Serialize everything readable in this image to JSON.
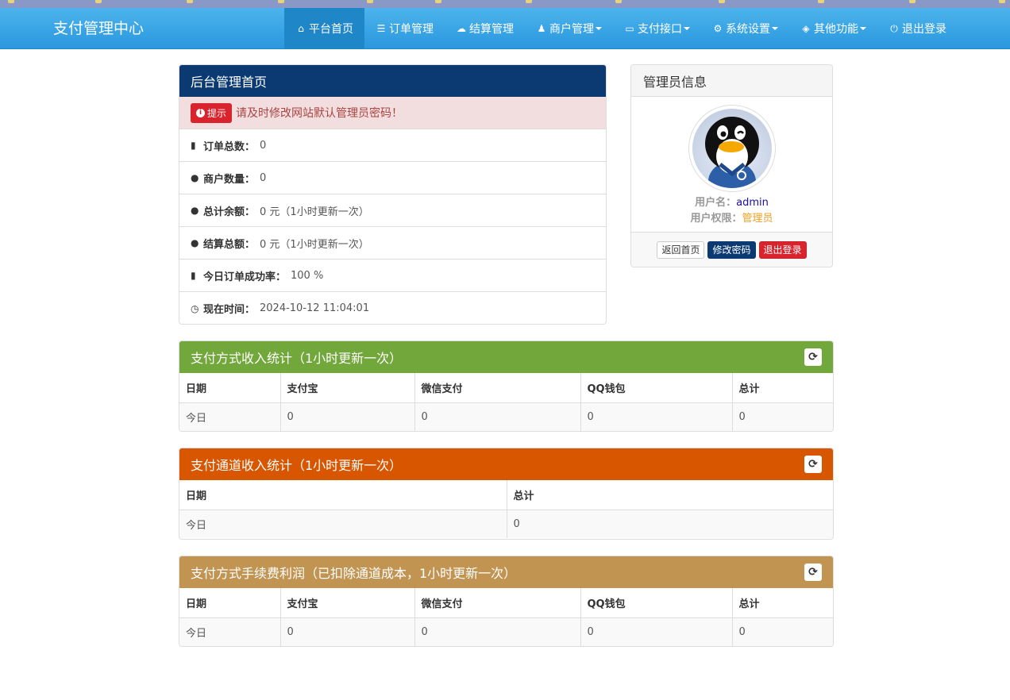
{
  "colors": {
    "navbar": "#2a98de",
    "dashboard_head": "#0b3a73",
    "pay_head": "#72a73b",
    "channel_head": "#d95600",
    "fee_head": "#c19452"
  },
  "brand": "支付管理中心",
  "nav": [
    {
      "label": "平台首页",
      "icon": "home-icon",
      "glyph": "⌂",
      "dropdown": false,
      "active": true
    },
    {
      "label": "订单管理",
      "icon": "list-icon",
      "glyph": "☰",
      "dropdown": false,
      "active": false
    },
    {
      "label": "结算管理",
      "icon": "cloud-icon",
      "glyph": "☁",
      "dropdown": false,
      "active": false
    },
    {
      "label": "商户管理",
      "icon": "user-icon",
      "glyph": "♟",
      "dropdown": true,
      "active": false
    },
    {
      "label": "支付接口",
      "icon": "credit-card-icon",
      "glyph": "▭",
      "dropdown": true,
      "active": false
    },
    {
      "label": "系统设置",
      "icon": "gear-icon",
      "glyph": "⚙",
      "dropdown": true,
      "active": false
    },
    {
      "label": "其他功能",
      "icon": "cube-icon",
      "glyph": "◈",
      "dropdown": true,
      "active": false
    },
    {
      "label": "退出登录",
      "icon": "power-icon",
      "glyph": "⏻",
      "dropdown": false,
      "active": false
    }
  ],
  "dashboard": {
    "title": "后台管理首页",
    "alert_badge": "提示",
    "alert_text": "请及时修改网站默认管理员密码！",
    "stats": [
      {
        "icon": "bar-chart-icon",
        "glyph": "▮",
        "label": "订单总数：",
        "value": "0"
      },
      {
        "icon": "tint-icon",
        "glyph": "●",
        "label": "商户数量：",
        "value": "0"
      },
      {
        "icon": "tint-icon",
        "glyph": "●",
        "label": "总计余额：",
        "value": "0 元（1小时更新一次）"
      },
      {
        "icon": "tint-icon",
        "glyph": "●",
        "label": "结算总额：",
        "value": "0 元（1小时更新一次）"
      },
      {
        "icon": "bar-chart-icon",
        "glyph": "▮",
        "label": "今日订单成功率：",
        "value": "100 %"
      },
      {
        "icon": "clock-icon",
        "glyph": "◷",
        "label": "现在时间：",
        "value": " 2024-10-12 11:04:01"
      }
    ]
  },
  "admin": {
    "title": "管理员信息",
    "username_label": "用户名：",
    "username": "admin",
    "role_label": "用户权限：",
    "role": "管理员",
    "btn_home": "返回首页",
    "btn_password": "修改密码",
    "btn_logout": "退出登录"
  },
  "pay_stats": {
    "title": "支付方式收入统计（1小时更新一次）",
    "headers": [
      "日期",
      "支付宝",
      "微信支付",
      "QQ钱包",
      "总计"
    ],
    "rows": [
      [
        "今日",
        "0",
        "0",
        "0",
        "0"
      ]
    ]
  },
  "channel_stats": {
    "title": "支付通道收入统计（1小时更新一次）",
    "headers": [
      "日期",
      "总计"
    ],
    "rows": [
      [
        "今日",
        "0"
      ]
    ]
  },
  "fee_stats": {
    "title": "支付方式手续费利润（已扣除通道成本，1小时更新一次）",
    "headers": [
      "日期",
      "支付宝",
      "微信支付",
      "QQ钱包",
      "总计"
    ],
    "rows": [
      [
        "今日",
        "0",
        "0",
        "0",
        "0"
      ]
    ]
  }
}
